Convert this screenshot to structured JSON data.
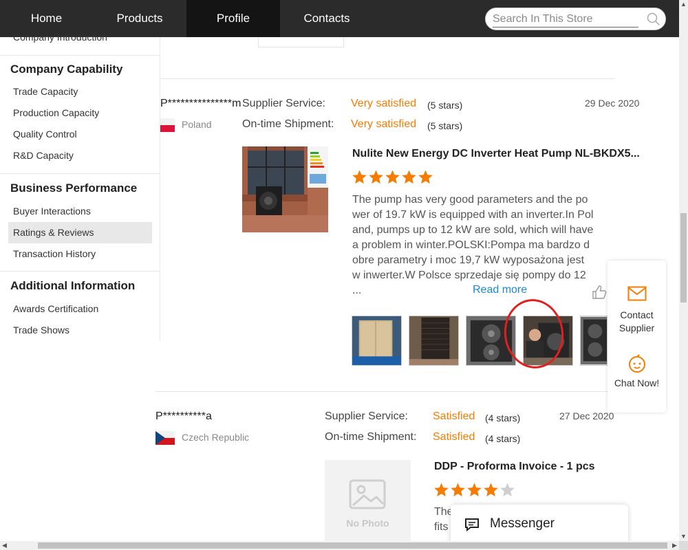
{
  "nav": {
    "items": [
      {
        "label": "Home",
        "active": false
      },
      {
        "label": "Products",
        "active": false
      },
      {
        "label": "Profile",
        "active": true
      },
      {
        "label": "Contacts",
        "active": false
      }
    ],
    "search_placeholder": "Search In This Store"
  },
  "sidebar": {
    "cut_item": "Company Introduction",
    "sections": [
      {
        "heading": "Company Capability",
        "items": [
          "Trade Capacity",
          "Production Capacity",
          "Quality Control",
          "R&D Capacity"
        ]
      },
      {
        "heading": "Business Performance",
        "items": [
          "Buyer Interactions",
          "Ratings & Reviews",
          "Transaction History"
        ]
      },
      {
        "heading": "Additional Information",
        "items": [
          "Awards Certification",
          "Trade Shows"
        ]
      }
    ],
    "active_item": "Ratings & Reviews"
  },
  "reviews": [
    {
      "user": "P***************m",
      "country": "Poland",
      "date": "29 Dec 2020",
      "supplier_service_label": "Supplier Service:",
      "supplier_service": "Very satisfied",
      "supplier_service_stars": "(5 stars)",
      "shipment_label": "On-time Shipment:",
      "shipment": "Very satisfied",
      "shipment_stars": "(5 stars)",
      "product_title": "Nulite New Energy DC Inverter Heat Pump NL-BKDX5...",
      "rating": 5,
      "body": "The pump has very good parameters and the power of 19.7 kW is equipped with an inverter.In Poland, pumps up to 12 kW are sold, which will have a problem in winter.POLSKI:Pompa ma bardzo dobre parametry i moc 19,7 kW wyposażona jest w inwerter.W Polsce sprzedaje się pompy do 12 ...",
      "read_more": "Read more"
    },
    {
      "user": "P**********a",
      "country": "Czech Republic",
      "date": "27 Dec 2020",
      "supplier_service_label": "Supplier Service:",
      "supplier_service": "Satisfied",
      "supplier_service_stars": "(4 stars)",
      "shipment_label": "On-time Shipment:",
      "shipment": "Satisfied",
      "shipment_stars": "(4 stars)",
      "product_title": "DDP - Proforma Invoice - 1 pcs",
      "rating": 4,
      "no_photo": "No Photo",
      "body_partial_1": "The",
      "body_partial_2": "fits"
    }
  ],
  "float_panel": {
    "contact_label_1": "Contact",
    "contact_label_2": "Supplier",
    "chat_label": "Chat Now!"
  },
  "messenger": {
    "label": "Messenger"
  },
  "colors": {
    "accent": "#f57c00",
    "link": "#1a8ad6",
    "nav_bg": "#2b2b2b",
    "highlight_circle": "#e0201e"
  }
}
